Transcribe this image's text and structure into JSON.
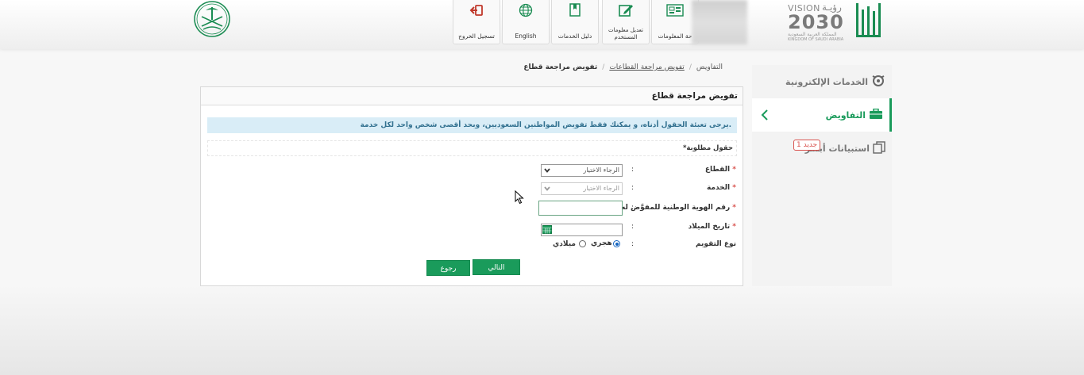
{
  "header": {
    "emblem_icon": "saudi-emblem-icon",
    "vision_logo": {
      "vision_label": "VISION",
      "vision_ar": "رؤيـة",
      "year": "2030",
      "kingdom_ar": "المملكة العربية السعودية",
      "kingdom_en": "KINGDOM OF SAUDI ARABIA"
    },
    "nav": [
      {
        "label": "تسجيل الخروج",
        "icon": "logout-icon"
      },
      {
        "label": "English",
        "icon": "globe-icon"
      },
      {
        "label": "دليل الخدمات",
        "icon": "book-icon"
      },
      {
        "label": "تعديل معلومات المستخدم",
        "icon": "edit-icon"
      },
      {
        "label": "حة المعلومات",
        "icon": "dashboard-icon"
      }
    ]
  },
  "sidebar": {
    "items": [
      {
        "label": "الخدمات الإلكترونية",
        "icon": "services-icon"
      },
      {
        "label": "التفاويض",
        "icon": "briefcase-icon"
      },
      {
        "label": "استبيانات أبشر",
        "icon": "documents-icon",
        "badge": "جديد 1"
      }
    ]
  },
  "breadcrumb": {
    "items": [
      "التفاويض",
      "تفويض مراجعة القطاعات",
      "تفويض مراجعة قطاع"
    ],
    "separator": "/"
  },
  "panel": {
    "title": "تفويض مراجعة قطاع",
    "info": "يرجى تعبئة الحقول أدناه، و يمكنك فقط تفويض المواطنين السعوديين، وبحد أقصى شخص واحد لكل خدمة.",
    "required_note": "*حقول مطلوبة"
  },
  "form": {
    "colon": ":",
    "sector": {
      "label": "القطاع",
      "value": "الرجاء الاختيار"
    },
    "service": {
      "label": "الخدمة",
      "value": "الرجاء الاختيار"
    },
    "national_id": {
      "label": "رقم الهوية الوطنية للمفوَّض له",
      "value": ""
    },
    "birth_date": {
      "label": "تاريخ الميلاد",
      "value": ""
    },
    "calendar_type": {
      "label": "نوع التقويم",
      "options": [
        "هجري",
        "ميلادي"
      ],
      "selected": "هجري"
    },
    "star": "*"
  },
  "buttons": {
    "next": "التالي",
    "back": "رجوع"
  },
  "colors": {
    "accent": "#1a9b5b",
    "info_bg": "#d9edf7",
    "info_text": "#31708f",
    "required": "#d9534f"
  }
}
